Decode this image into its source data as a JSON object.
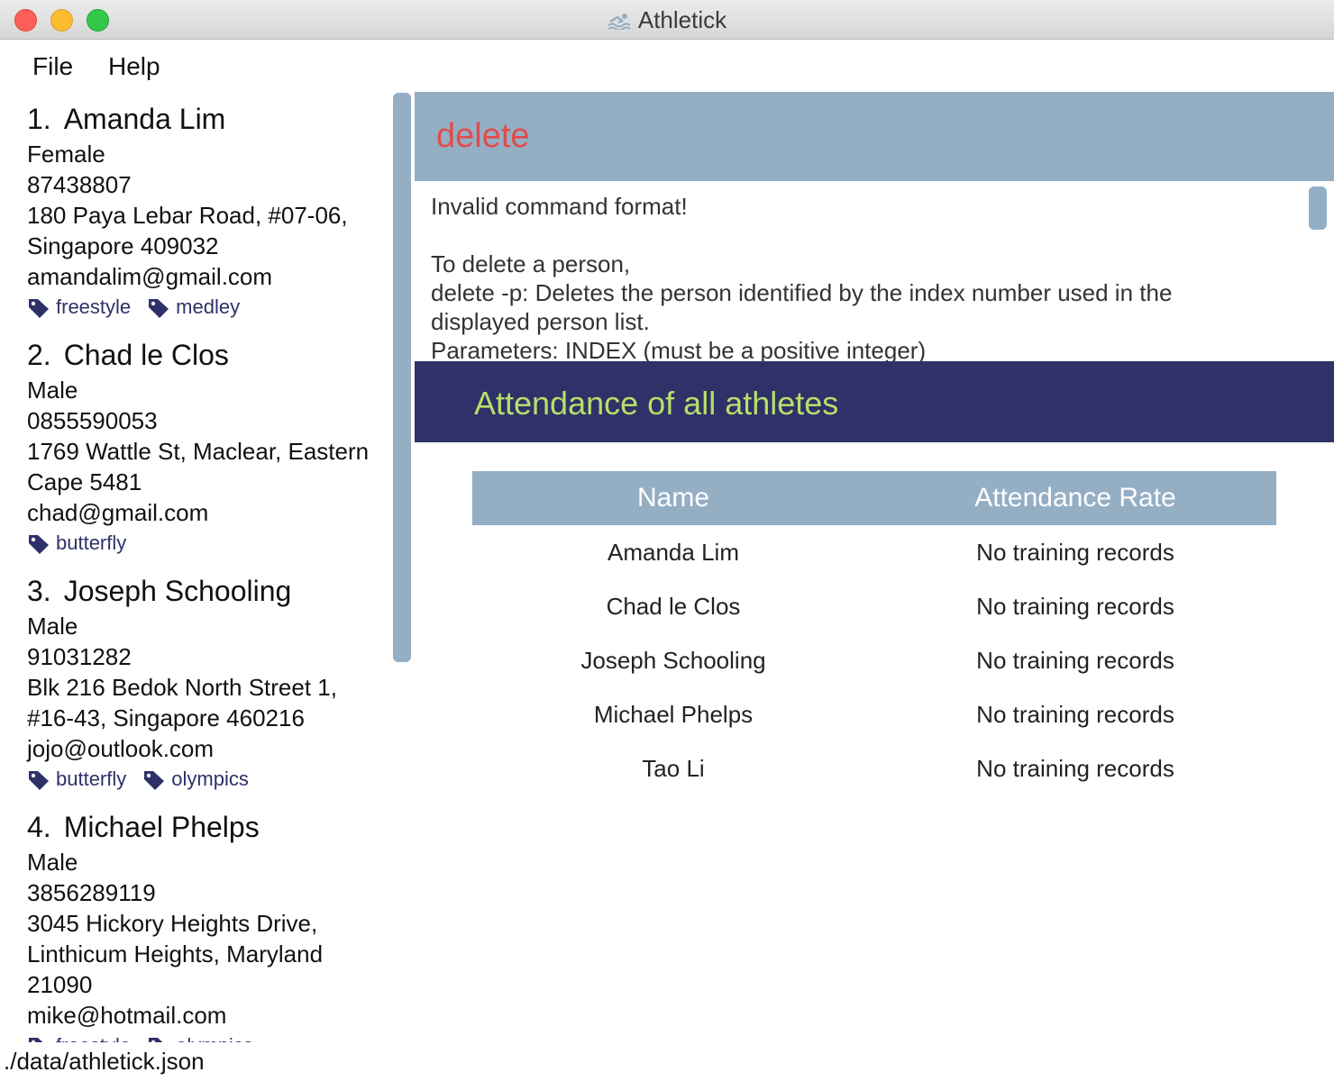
{
  "window": {
    "title": "Athletick"
  },
  "menu": {
    "file": "File",
    "help": "Help"
  },
  "persons": [
    {
      "index": "1.",
      "name": "Amanda Lim",
      "gender": "Female",
      "phone": "87438807",
      "address_lines": [
        "180 Paya Lebar Road, #07-06,",
        "Singapore 409032"
      ],
      "email": "amandalim@gmail.com",
      "tags": [
        "freestyle",
        "medley"
      ]
    },
    {
      "index": "2.",
      "name": "Chad le Clos",
      "gender": "Male",
      "phone": "0855590053",
      "address_lines": [
        "1769 Wattle St, Maclear, Eastern",
        "Cape 5481"
      ],
      "email": "chad@gmail.com",
      "tags": [
        "butterfly"
      ]
    },
    {
      "index": "3.",
      "name": "Joseph Schooling",
      "gender": "Male",
      "phone": "91031282",
      "address_lines": [
        "Blk 216 Bedok North Street 1,",
        "#16-43, Singapore 460216"
      ],
      "email": "jojo@outlook.com",
      "tags": [
        "butterfly",
        "olympics"
      ]
    },
    {
      "index": "4.",
      "name": "Michael Phelps",
      "gender": "Male",
      "phone": "3856289119",
      "address_lines": [
        "3045 Hickory Heights Drive,",
        "Linthicum Heights, Maryland",
        "21090"
      ],
      "email": "mike@hotmail.com",
      "tags": [
        "freestyle",
        "olympics"
      ]
    }
  ],
  "command": {
    "text": "delete"
  },
  "result": {
    "text": "Invalid command format!\n\nTo delete a person,\ndelete -p: Deletes the person identified by the index number used in the displayed person list.\nParameters: INDEX (must be a positive integer)"
  },
  "attendance": {
    "title": "Attendance of all athletes",
    "columns": [
      "Name",
      "Attendance Rate"
    ],
    "rows": [
      [
        "Amanda Lim",
        "No training records"
      ],
      [
        "Chad le Clos",
        "No training records"
      ],
      [
        "Joseph Schooling",
        "No training records"
      ],
      [
        "Michael Phelps",
        "No training records"
      ],
      [
        "Tao Li",
        "No training records"
      ]
    ]
  },
  "status": {
    "file_path": "./data/athletick.json"
  },
  "colors": {
    "accent_blue": "#94aec4",
    "navy": "#2f3168",
    "command_red": "#e24b4b",
    "title_green": "#b8de6a"
  }
}
